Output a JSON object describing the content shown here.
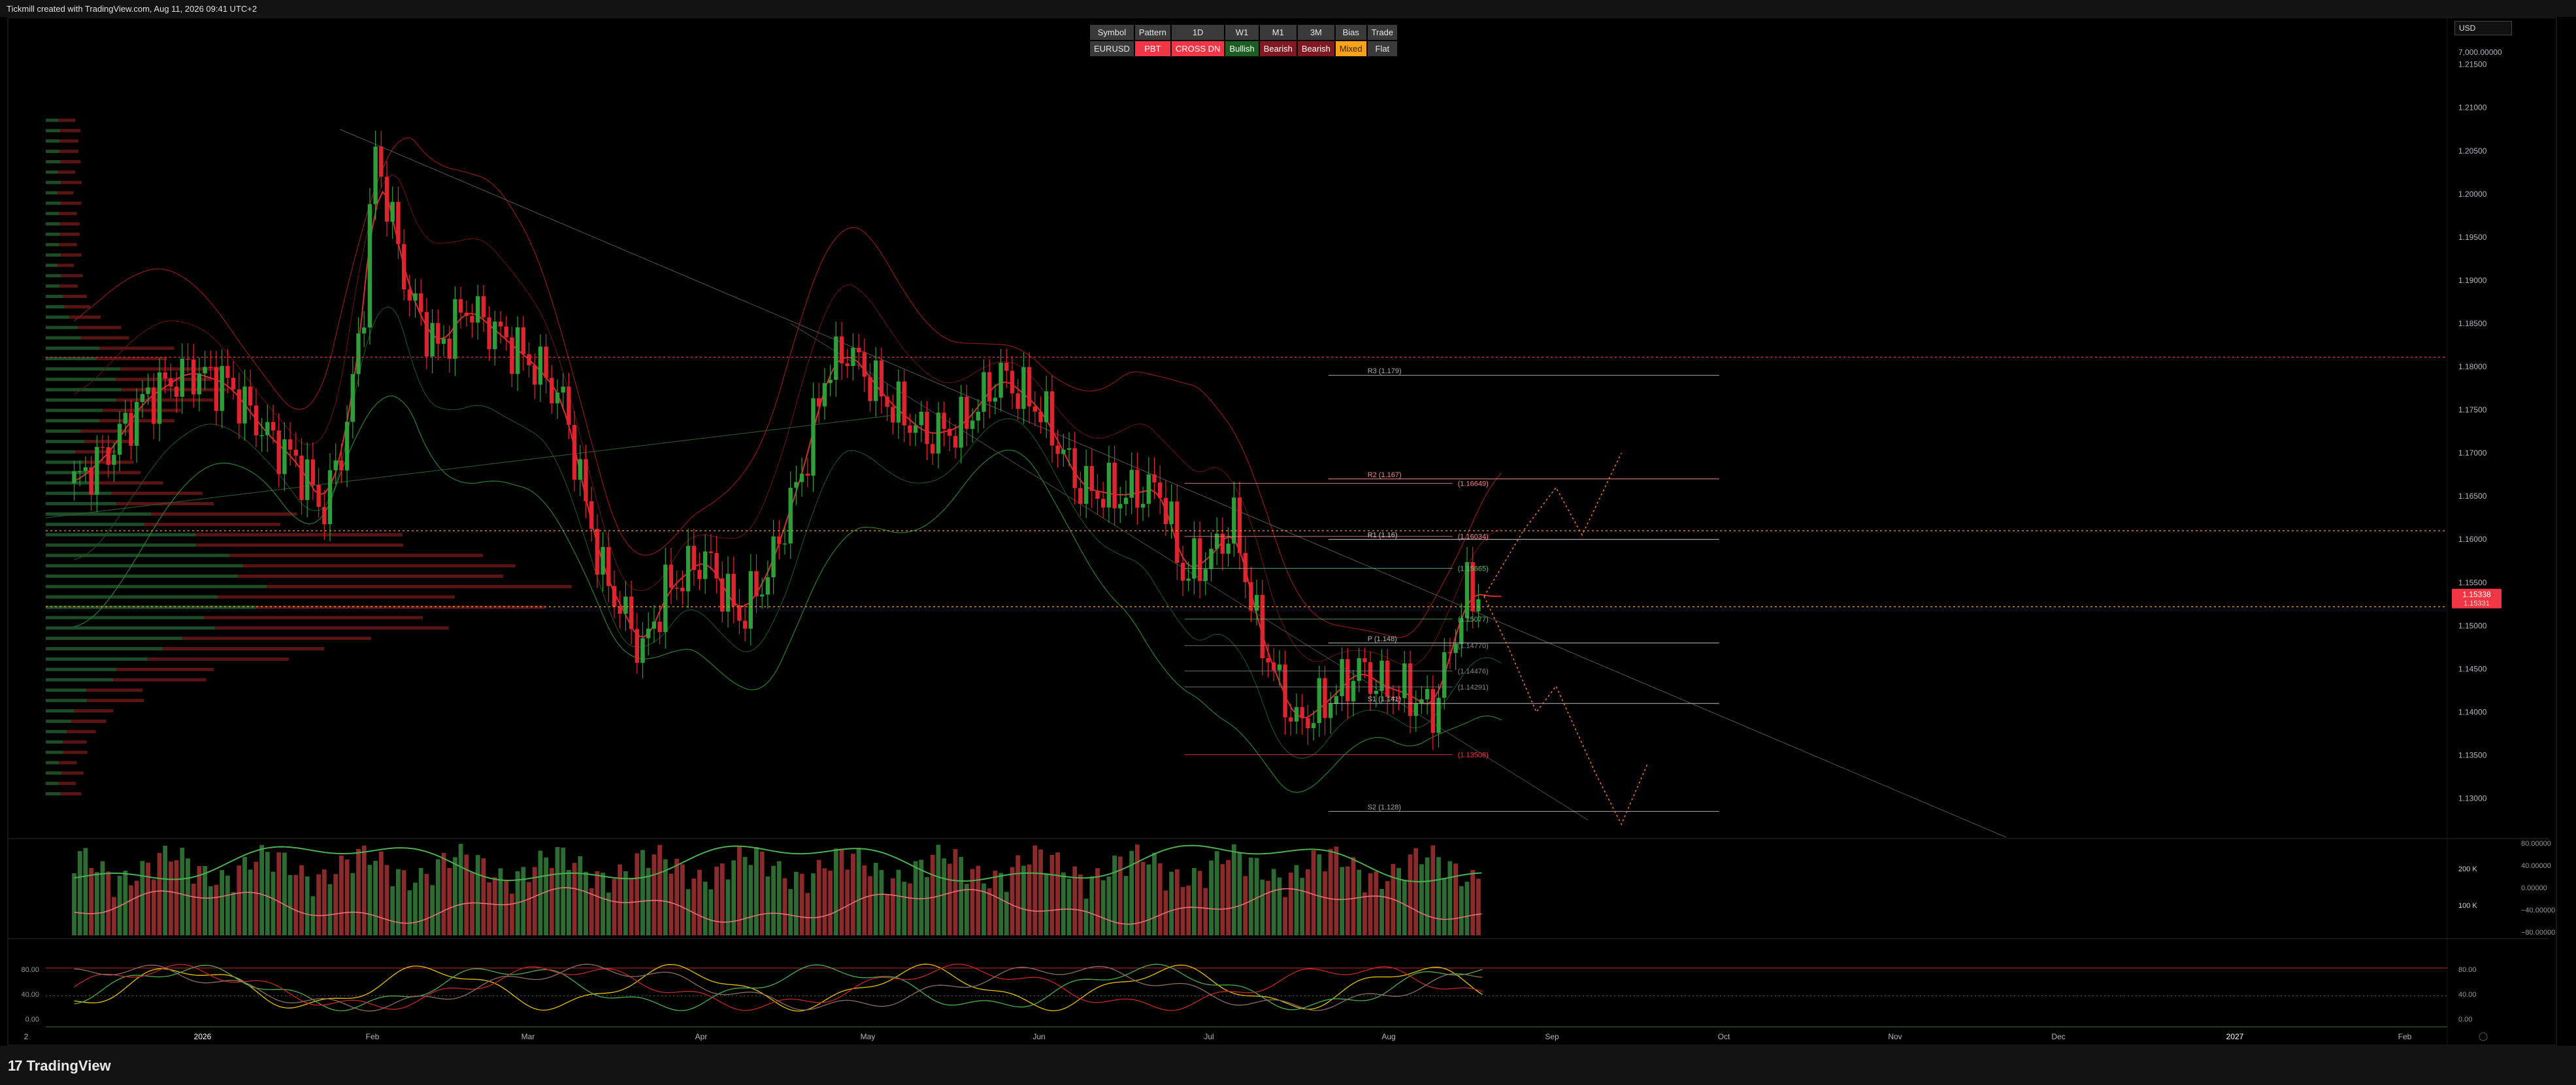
{
  "header": {
    "caption": "Tickmill created with TradingView.com, Aug 11, 2026 09:41 UTC+2"
  },
  "footer": {
    "brand": "TradingView"
  },
  "currency_selector": {
    "value": "USD"
  },
  "signal_table": {
    "headers": [
      "Symbol",
      "Pattern",
      "1D",
      "W1",
      "M1",
      "3M",
      "Bias",
      "Trade"
    ],
    "cells": [
      {
        "text": "EURUSD",
        "bg": "#3a3a3a",
        "fg": "#e6e6e6"
      },
      {
        "text": "PBT",
        "bg": "#f23645",
        "fg": "#ffffff"
      },
      {
        "text": "CROSS DN",
        "bg": "#f23645",
        "fg": "#ffffff"
      },
      {
        "text": "Bullish",
        "bg": "#1b5e20",
        "fg": "#ffffff"
      },
      {
        "text": "Bearish",
        "bg": "#801922",
        "fg": "#ffffff"
      },
      {
        "text": "Bearish",
        "bg": "#801922",
        "fg": "#ffffff"
      },
      {
        "text": "Mixed",
        "bg": "#f7a21b",
        "fg": "#3a2500"
      },
      {
        "text": "Flat",
        "bg": "#3a3a3a",
        "fg": "#e6e6e6"
      }
    ]
  },
  "colors": {
    "bull": "#26a69a",
    "bull_dark": "#2e7d32",
    "bear": "#f23645",
    "bear_dark": "#8b1a1a",
    "grid": "#111111"
  },
  "chart_data": {
    "type": "candlestick",
    "symbol": "EURUSD",
    "x_labels": [
      "2",
      "2026",
      "Feb",
      "Mar",
      "Apr",
      "May",
      "Jun",
      "Jul",
      "Aug",
      "Sep",
      "Oct",
      "Nov",
      "Dec",
      "2027",
      "Feb"
    ],
    "price_axis": {
      "ticks": [
        "7,000.00000",
        "1.21500",
        "1.21000",
        "1.20500",
        "1.20000",
        "1.19500",
        "1.19000",
        "1.18500",
        "1.18000",
        "1.17500",
        "1.17000",
        "1.16500",
        "1.16000",
        "1.15500",
        "1.15000",
        "1.14500",
        "1.14000",
        "1.13500",
        "1.13000"
      ],
      "ylim": [
        1.1255,
        1.2205
      ],
      "current_price": "1.15338",
      "current_sub": "1.15331"
    },
    "price_path": [
      [
        "2025-12-06",
        1.1665
      ],
      [
        "2025-12-12",
        1.17
      ],
      [
        "2025-12-18",
        1.176
      ],
      [
        "2025-12-26",
        1.1795
      ],
      [
        "2026-01-02",
        1.178
      ],
      [
        "2026-01-09",
        1.172
      ],
      [
        "2026-01-14",
        1.169
      ],
      [
        "2026-01-19",
        1.1635
      ],
      [
        "2026-01-23",
        1.173
      ],
      [
        "2026-01-26",
        1.188
      ],
      [
        "2026-01-28",
        1.205
      ],
      [
        "2026-02-03",
        1.188
      ],
      [
        "2026-02-08",
        1.182
      ],
      [
        "2026-02-13",
        1.187
      ],
      [
        "2026-02-20",
        1.183
      ],
      [
        "2026-02-26",
        1.1795
      ],
      [
        "2026-03-02",
        1.176
      ],
      [
        "2026-03-06",
        1.164
      ],
      [
        "2026-03-09",
        1.156
      ],
      [
        "2026-03-13",
        1.151
      ],
      [
        "2026-03-16",
        1.147
      ],
      [
        "2026-03-20",
        1.154
      ],
      [
        "2026-03-27",
        1.158
      ],
      [
        "2026-04-02",
        1.151
      ],
      [
        "2026-04-07",
        1.156
      ],
      [
        "2026-04-10",
        1.162
      ],
      [
        "2026-04-14",
        1.17
      ],
      [
        "2026-04-17",
        1.179
      ],
      [
        "2026-04-21",
        1.182
      ],
      [
        "2026-04-28",
        1.176
      ],
      [
        "2026-05-05",
        1.172
      ],
      [
        "2026-05-11",
        1.173
      ],
      [
        "2026-05-18",
        1.179
      ],
      [
        "2026-05-25",
        1.175
      ],
      [
        "2026-06-01",
        1.166
      ],
      [
        "2026-06-08",
        1.165
      ],
      [
        "2026-06-15",
        1.166
      ],
      [
        "2026-06-19",
        1.156
      ],
      [
        "2026-06-24",
        1.158
      ],
      [
        "2026-06-28",
        1.162
      ],
      [
        "2026-07-02",
        1.15
      ],
      [
        "2026-07-06",
        1.143
      ],
      [
        "2026-07-09",
        1.1385
      ],
      [
        "2026-07-14",
        1.141
      ],
      [
        "2026-07-20",
        1.145
      ],
      [
        "2026-07-24",
        1.143
      ],
      [
        "2026-07-29",
        1.142
      ],
      [
        "2026-08-02",
        1.14
      ],
      [
        "2026-08-05",
        1.147
      ],
      [
        "2026-08-08",
        1.154
      ],
      [
        "2026-08-11",
        1.1534
      ]
    ],
    "levels": [
      {
        "label": "R3 (1.179)",
        "value": 1.179,
        "color": "#aaaaaa"
      },
      {
        "label": "R2 (1.167)",
        "value": 1.167,
        "color": "#f28b8b"
      },
      {
        "label": "R1 (1.16)",
        "value": 1.16,
        "color": "#cccccc"
      },
      {
        "label": "P (1.148)",
        "value": 1.148,
        "color": "#bbbbbb"
      },
      {
        "label": "S1 (1.141)",
        "value": 1.141,
        "color": "#bbbbbb"
      },
      {
        "label": "S2 (1.128)",
        "value": 1.1285,
        "color": "#aaaaaa"
      }
    ],
    "level_tags": [
      {
        "label": "(1.16649)",
        "value": 1.16649,
        "color": "#f28b8b"
      },
      {
        "label": "(1.16034)",
        "value": 1.16034,
        "color": "#f28b8b"
      },
      {
        "label": "(1.15665)",
        "value": 1.15665,
        "color": "#66bb6a"
      },
      {
        "label": "(1.15077)",
        "value": 1.15077,
        "color": "#66bb6a"
      },
      {
        "label": "(1.14770)",
        "value": 1.1477,
        "color": "#888888"
      },
      {
        "label": "(1.14476)",
        "value": 1.14476,
        "color": "#888888"
      },
      {
        "label": "(1.14291)",
        "value": 1.14291,
        "color": "#888888"
      },
      {
        "label": "(1.13508)",
        "value": 1.13508,
        "color": "#f23645"
      }
    ],
    "dashed_lines": [
      {
        "value": 1.1811,
        "color": "#f23645"
      },
      {
        "value": 1.161,
        "color": "#f7a21b"
      },
      {
        "value": 1.1522,
        "color": "#f7a21b"
      }
    ],
    "volume_axis": {
      "labels": [
        "200 K",
        "100 K"
      ]
    },
    "sentiment_axis": {
      "labels": [
        "80.00000",
        "40.00000",
        "0.00000",
        "−40.00000",
        "−80.00000"
      ]
    },
    "oscillator_axis": {
      "labels_left": [
        "80.00",
        "40.00",
        "0.00"
      ],
      "labels_right": [
        "80.00",
        "40.00",
        "0.00"
      ]
    }
  }
}
